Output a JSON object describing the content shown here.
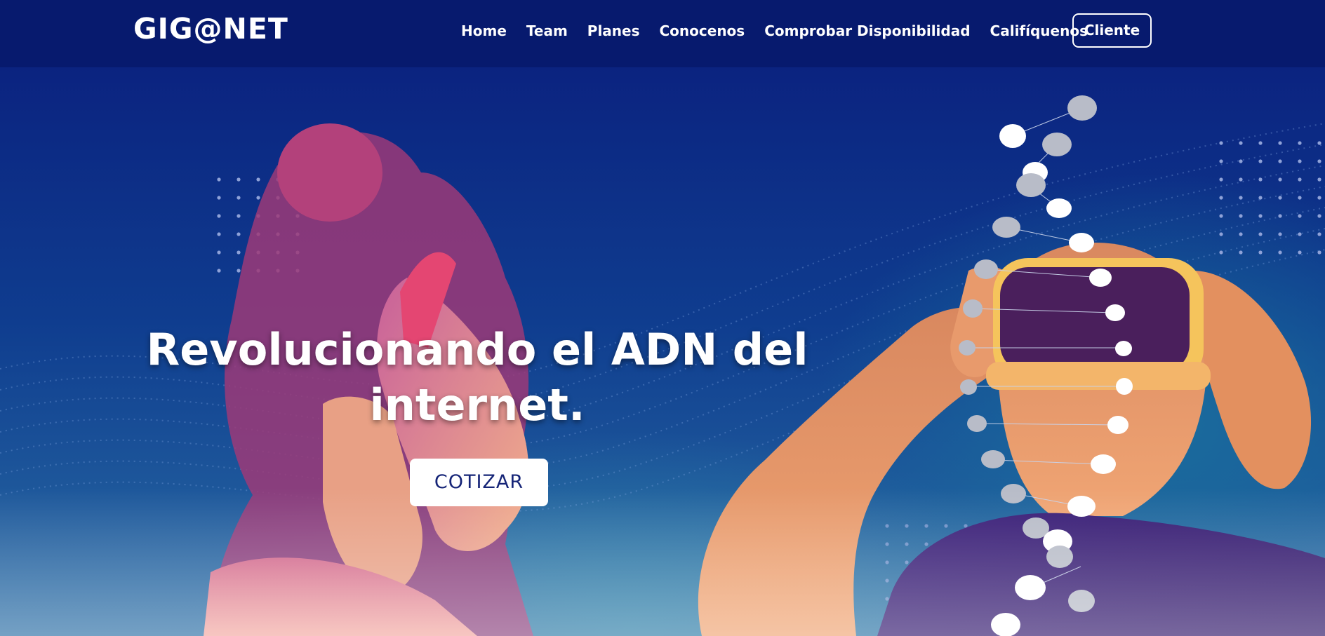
{
  "header": {
    "logo": "GIG@NET",
    "nav": [
      "Home",
      "Team",
      "Planes",
      "Conocenos",
      "Comprobar Disponibilidad",
      "Califíquenos"
    ],
    "client_button": "Cliente"
  },
  "hero": {
    "headline": "Revolucionando el ADN del internet.",
    "cta_label": "COTIZAR"
  },
  "colors": {
    "navbar_bg": "#071a6e",
    "cta_text": "#152477",
    "hero_top": "#0b2380",
    "hero_bottom": "#2a6ea5"
  }
}
